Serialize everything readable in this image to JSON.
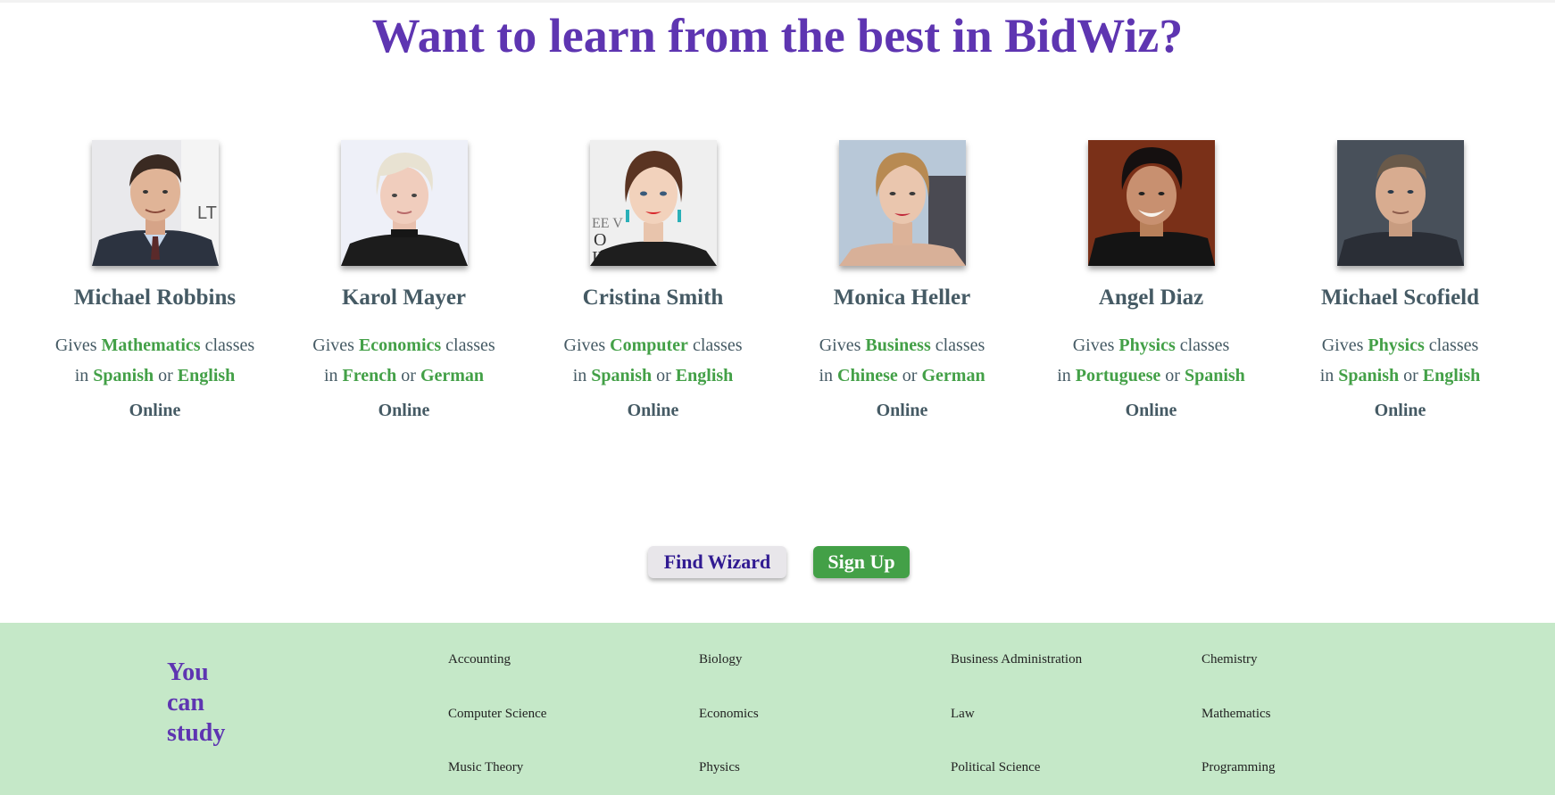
{
  "hero": {
    "title": "Want to learn from the best in BidWiz?"
  },
  "tutors": [
    {
      "name": "Michael Robbins",
      "gives": "Gives",
      "subject": "Mathematics",
      "classes": "classes",
      "in": "in",
      "lang1": "Spanish",
      "or": "or",
      "lang2": "English",
      "mode": "Online"
    },
    {
      "name": "Karol Mayer",
      "gives": "Gives",
      "subject": "Economics",
      "classes": "classes",
      "in": "in",
      "lang1": "French",
      "or": "or",
      "lang2": "German",
      "mode": "Online"
    },
    {
      "name": "Cristina Smith",
      "gives": "Gives",
      "subject": "Computer",
      "classes": "classes",
      "in": "in",
      "lang1": "Spanish",
      "or": "or",
      "lang2": "English",
      "mode": "Online"
    },
    {
      "name": "Monica Heller",
      "gives": "Gives",
      "subject": "Business",
      "classes": "classes",
      "in": "in",
      "lang1": "Chinese",
      "or": "or",
      "lang2": "German",
      "mode": "Online"
    },
    {
      "name": "Angel Diaz",
      "gives": "Gives",
      "subject": "Physics",
      "classes": "classes",
      "in": "in",
      "lang1": "Portuguese",
      "or": "or",
      "lang2": "Spanish",
      "mode": "Online"
    },
    {
      "name": "Michael Scofield",
      "gives": "Gives",
      "subject": "Physics",
      "classes": "classes",
      "in": "in",
      "lang1": "Spanish",
      "or": "or",
      "lang2": "English",
      "mode": "Online"
    }
  ],
  "actions": {
    "find_label": "Find Wizard",
    "signup_label": "Sign Up"
  },
  "footer": {
    "study_line1": "You",
    "study_line2": "can",
    "study_line3": "study",
    "subjects": [
      "Accounting",
      "Biology",
      "Business Administration",
      "Chemistry",
      "Computer Science",
      "Economics",
      "Law",
      "Mathematics",
      "Music Theory",
      "Physics",
      "Political Science",
      "Programming"
    ]
  },
  "colors": {
    "title": "#5e35b1",
    "accent_green": "#43a047",
    "text_slate": "#455a64",
    "footer_bg": "#c5e8c8",
    "find_button_text": "#311b92"
  }
}
